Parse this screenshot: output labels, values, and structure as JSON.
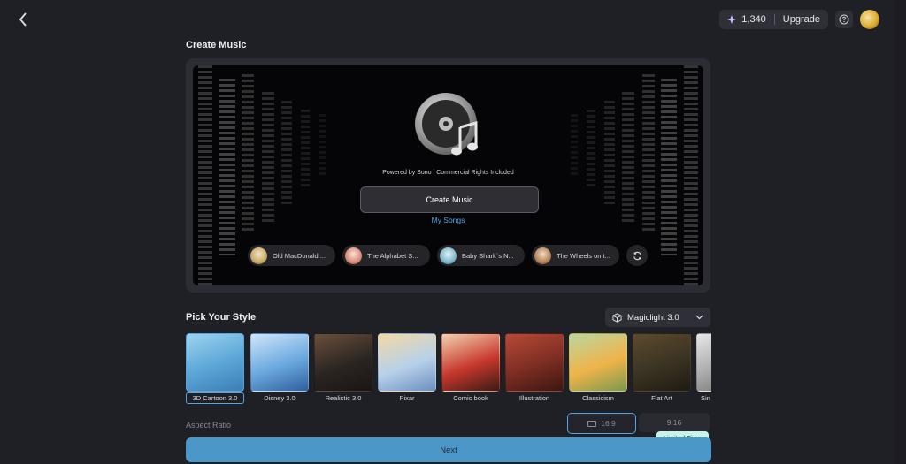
{
  "header": {
    "credits_value": "1,340",
    "upgrade_label": "Upgrade"
  },
  "create": {
    "title": "Create Music",
    "powered_text": "Powered by Suno | Commercial Rights Included",
    "button_label": "Create Music",
    "my_songs_label": "My Songs",
    "songs": [
      {
        "title": "Old MacDonald ...",
        "thumb": "#c9a96a"
      },
      {
        "title": "The Alphabet S...",
        "thumb": "#d98c7a"
      },
      {
        "title": "Baby Shark`s N...",
        "thumb": "#7fb6c8"
      },
      {
        "title": "The Wheels on t...",
        "thumb": "#b5835b"
      }
    ]
  },
  "style": {
    "title": "Pick Your Style",
    "model_label": "Magiclight 3.0",
    "items": [
      {
        "label": "3D Cartoon 3.0",
        "bg": "linear-gradient(160deg,#9cd3f0,#5aa5d6 55%,#3b7fb5)",
        "selected": true
      },
      {
        "label": "Disney 3.0",
        "bg": "linear-gradient(160deg,#cfe6fb,#6aa8de 55%,#2f5f9e)"
      },
      {
        "label": "Realistic 3.0",
        "bg": "linear-gradient(160deg,#6a4f3c,#2b2522 55%,#1a1412)"
      },
      {
        "label": "Pixar",
        "bg": "linear-gradient(160deg,#f3d9a4,#b7d1ea 55%,#6d8fc0)"
      },
      {
        "label": "Comic book",
        "bg": "linear-gradient(160deg,#f2d2b0,#c7372c 55%,#3b1b16)"
      },
      {
        "label": "Illustration",
        "bg": "linear-gradient(160deg,#b84a36,#7c2d22 55%,#3d1712)"
      },
      {
        "label": "Classicism",
        "bg": "linear-gradient(160deg,#b9d7a0,#f0b34a 55%,#7a9a4f)"
      },
      {
        "label": "Flat Art",
        "bg": "linear-gradient(160deg,#5d4a2f,#3a3322 55%,#1f1b12)"
      },
      {
        "label": "Sin",
        "bg": "linear-gradient(160deg,#e6e6e6,#a9a9a9 55%,#6f6f6f)"
      }
    ]
  },
  "aspect": {
    "label": "Aspect Ratio",
    "options": [
      "16:9",
      "9:16"
    ],
    "badge": "Limited Time"
  },
  "next_label": "Next"
}
